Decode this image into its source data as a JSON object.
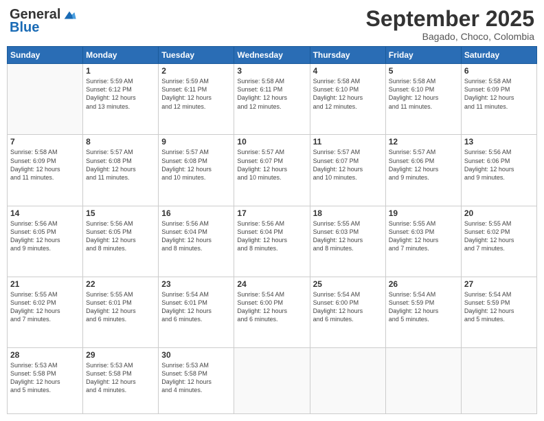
{
  "header": {
    "logo_line1": "General",
    "logo_line2": "Blue",
    "month": "September 2025",
    "location": "Bagado, Choco, Colombia"
  },
  "weekdays": [
    "Sunday",
    "Monday",
    "Tuesday",
    "Wednesday",
    "Thursday",
    "Friday",
    "Saturday"
  ],
  "weeks": [
    [
      {
        "day": "",
        "info": ""
      },
      {
        "day": "1",
        "info": "Sunrise: 5:59 AM\nSunset: 6:12 PM\nDaylight: 12 hours\nand 13 minutes."
      },
      {
        "day": "2",
        "info": "Sunrise: 5:59 AM\nSunset: 6:11 PM\nDaylight: 12 hours\nand 12 minutes."
      },
      {
        "day": "3",
        "info": "Sunrise: 5:58 AM\nSunset: 6:11 PM\nDaylight: 12 hours\nand 12 minutes."
      },
      {
        "day": "4",
        "info": "Sunrise: 5:58 AM\nSunset: 6:10 PM\nDaylight: 12 hours\nand 12 minutes."
      },
      {
        "day": "5",
        "info": "Sunrise: 5:58 AM\nSunset: 6:10 PM\nDaylight: 12 hours\nand 11 minutes."
      },
      {
        "day": "6",
        "info": "Sunrise: 5:58 AM\nSunset: 6:09 PM\nDaylight: 12 hours\nand 11 minutes."
      }
    ],
    [
      {
        "day": "7",
        "info": "Sunrise: 5:58 AM\nSunset: 6:09 PM\nDaylight: 12 hours\nand 11 minutes."
      },
      {
        "day": "8",
        "info": "Sunrise: 5:57 AM\nSunset: 6:08 PM\nDaylight: 12 hours\nand 11 minutes."
      },
      {
        "day": "9",
        "info": "Sunrise: 5:57 AM\nSunset: 6:08 PM\nDaylight: 12 hours\nand 10 minutes."
      },
      {
        "day": "10",
        "info": "Sunrise: 5:57 AM\nSunset: 6:07 PM\nDaylight: 12 hours\nand 10 minutes."
      },
      {
        "day": "11",
        "info": "Sunrise: 5:57 AM\nSunset: 6:07 PM\nDaylight: 12 hours\nand 10 minutes."
      },
      {
        "day": "12",
        "info": "Sunrise: 5:57 AM\nSunset: 6:06 PM\nDaylight: 12 hours\nand 9 minutes."
      },
      {
        "day": "13",
        "info": "Sunrise: 5:56 AM\nSunset: 6:06 PM\nDaylight: 12 hours\nand 9 minutes."
      }
    ],
    [
      {
        "day": "14",
        "info": "Sunrise: 5:56 AM\nSunset: 6:05 PM\nDaylight: 12 hours\nand 9 minutes."
      },
      {
        "day": "15",
        "info": "Sunrise: 5:56 AM\nSunset: 6:05 PM\nDaylight: 12 hours\nand 8 minutes."
      },
      {
        "day": "16",
        "info": "Sunrise: 5:56 AM\nSunset: 6:04 PM\nDaylight: 12 hours\nand 8 minutes."
      },
      {
        "day": "17",
        "info": "Sunrise: 5:56 AM\nSunset: 6:04 PM\nDaylight: 12 hours\nand 8 minutes."
      },
      {
        "day": "18",
        "info": "Sunrise: 5:55 AM\nSunset: 6:03 PM\nDaylight: 12 hours\nand 8 minutes."
      },
      {
        "day": "19",
        "info": "Sunrise: 5:55 AM\nSunset: 6:03 PM\nDaylight: 12 hours\nand 7 minutes."
      },
      {
        "day": "20",
        "info": "Sunrise: 5:55 AM\nSunset: 6:02 PM\nDaylight: 12 hours\nand 7 minutes."
      }
    ],
    [
      {
        "day": "21",
        "info": "Sunrise: 5:55 AM\nSunset: 6:02 PM\nDaylight: 12 hours\nand 7 minutes."
      },
      {
        "day": "22",
        "info": "Sunrise: 5:55 AM\nSunset: 6:01 PM\nDaylight: 12 hours\nand 6 minutes."
      },
      {
        "day": "23",
        "info": "Sunrise: 5:54 AM\nSunset: 6:01 PM\nDaylight: 12 hours\nand 6 minutes."
      },
      {
        "day": "24",
        "info": "Sunrise: 5:54 AM\nSunset: 6:00 PM\nDaylight: 12 hours\nand 6 minutes."
      },
      {
        "day": "25",
        "info": "Sunrise: 5:54 AM\nSunset: 6:00 PM\nDaylight: 12 hours\nand 6 minutes."
      },
      {
        "day": "26",
        "info": "Sunrise: 5:54 AM\nSunset: 5:59 PM\nDaylight: 12 hours\nand 5 minutes."
      },
      {
        "day": "27",
        "info": "Sunrise: 5:54 AM\nSunset: 5:59 PM\nDaylight: 12 hours\nand 5 minutes."
      }
    ],
    [
      {
        "day": "28",
        "info": "Sunrise: 5:53 AM\nSunset: 5:58 PM\nDaylight: 12 hours\nand 5 minutes."
      },
      {
        "day": "29",
        "info": "Sunrise: 5:53 AM\nSunset: 5:58 PM\nDaylight: 12 hours\nand 4 minutes."
      },
      {
        "day": "30",
        "info": "Sunrise: 5:53 AM\nSunset: 5:58 PM\nDaylight: 12 hours\nand 4 minutes."
      },
      {
        "day": "",
        "info": ""
      },
      {
        "day": "",
        "info": ""
      },
      {
        "day": "",
        "info": ""
      },
      {
        "day": "",
        "info": ""
      }
    ]
  ]
}
